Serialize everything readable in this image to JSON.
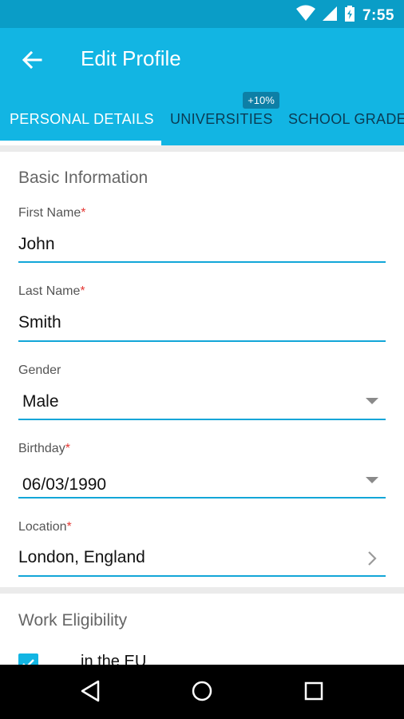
{
  "status_bar": {
    "time": "7:55",
    "icons": [
      "wifi-icon",
      "cell-signal-icon",
      "battery-charging-icon"
    ],
    "color": "#0a9dc7"
  },
  "app_bar": {
    "title": "Edit Profile",
    "color": "#12b5e3",
    "back_icon": "arrow-back-icon"
  },
  "tabs": [
    {
      "label": "PERSONAL DETAILS",
      "active": true
    },
    {
      "label": "UNIVERSITIES",
      "active": false,
      "badge": "+10%"
    },
    {
      "label": "SCHOOL GRADES",
      "active": false
    }
  ],
  "basic_info": {
    "title": "Basic Information",
    "fields": [
      {
        "label": "First Name",
        "required": "*",
        "value": "John"
      },
      {
        "label": "Last Name",
        "required": "*",
        "value": "Smith"
      },
      {
        "label": "Gender",
        "required": "",
        "value": "Male",
        "control": "dropdown"
      },
      {
        "label": "Birthday",
        "required": "*",
        "value": "06/03/1990",
        "control": "dropdown"
      },
      {
        "label": "Location",
        "required": "*",
        "value": "London, England",
        "control": "chevron"
      }
    ]
  },
  "work_eligibility": {
    "title": "Work Eligibility",
    "checkbox_label": "in the EU",
    "checked": true
  },
  "nav_bar": {
    "buttons": [
      "back-triangle-icon",
      "home-circle-icon",
      "recents-square-icon"
    ]
  },
  "accent_color": "#12a6d8",
  "required_color": "#e53935"
}
